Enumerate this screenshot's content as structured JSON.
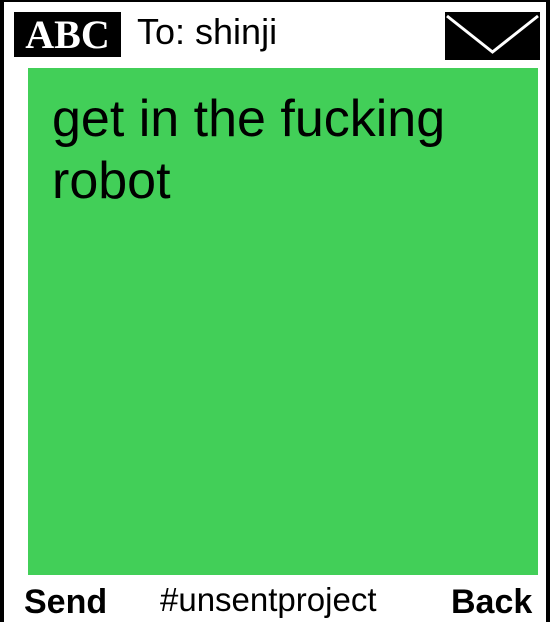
{
  "header": {
    "input_mode": "ABC",
    "recipient": "To: shinji",
    "icon": "envelope-icon"
  },
  "message": {
    "body": "get in the fucking robot",
    "background_color": "#42cf58"
  },
  "softkeys": {
    "left": "Send",
    "center": "#unsentproject",
    "right": "Back"
  }
}
